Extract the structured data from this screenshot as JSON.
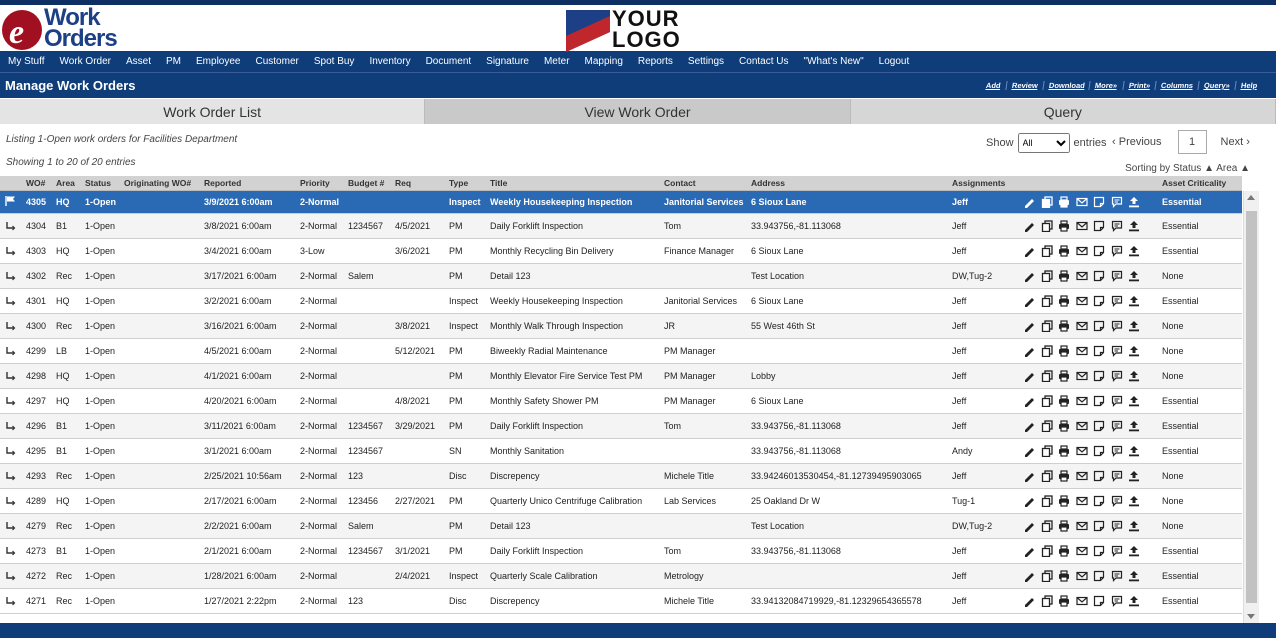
{
  "brand": {
    "logo_line1": "Work",
    "logo_line2": "Orders",
    "placeholder_line1": "YOUR",
    "placeholder_line2": "LOGO",
    "primary": "#0f3d7a",
    "accent": "#a01020"
  },
  "nav": [
    "My Stuff",
    "Work Order",
    "Asset",
    "PM",
    "Employee",
    "Customer",
    "Spot Buy",
    "Inventory",
    "Document",
    "Signature",
    "Meter",
    "Mapping",
    "Reports",
    "Settings",
    "Contact Us",
    "\"What's New\"",
    "Logout"
  ],
  "page_title": "Manage Work Orders",
  "actions": [
    "Add",
    "Review",
    "Download",
    "More»",
    "Print»",
    "Columns",
    "Query»",
    "Help"
  ],
  "tabs": [
    "Work Order List",
    "View Work Order",
    "Query"
  ],
  "listing": "Listing 1-Open work orders for Facilities Department",
  "showing": "Showing 1 to 20 of 20 entries",
  "show_label": "Show",
  "show_value": "All",
  "entries_label": "entries",
  "pager": {
    "previous": "Previous",
    "current": "1",
    "next": "Next"
  },
  "sorting": "Sorting by Status ▲ Area ▲",
  "columns": [
    "WO#",
    "Area",
    "Status",
    "Originating WO#",
    "Reported",
    "Priority",
    "Budget #",
    "Req",
    "Type",
    "Title",
    "Contact",
    "Address",
    "Assignments",
    "Asset Criticality"
  ],
  "row_icons": [
    "pencil-icon",
    "copy-icon",
    "print-icon",
    "email-icon",
    "note-icon",
    "comment-icon",
    "upload-icon"
  ],
  "rows": [
    {
      "wo": "4305",
      "area": "HQ",
      "status": "1-Open",
      "orig": "",
      "reported": "3/9/2021 6:00am",
      "priority": "2-Normal",
      "budget": "",
      "req": "",
      "type": "Inspect",
      "title": "Weekly Housekeeping Inspection",
      "contact": "Janitorial Services",
      "address": "6 Sioux Lane",
      "assign": "Jeff",
      "crit": "Essential"
    },
    {
      "wo": "4304",
      "area": "B1",
      "status": "1-Open",
      "orig": "",
      "reported": "3/8/2021 6:00am",
      "priority": "2-Normal",
      "budget": "1234567",
      "req": "4/5/2021",
      "type": "PM",
      "title": "Daily Forklift Inspection",
      "contact": "Tom",
      "address": "33.943756,-81.113068",
      "assign": "Jeff",
      "crit": "Essential"
    },
    {
      "wo": "4303",
      "area": "HQ",
      "status": "1-Open",
      "orig": "",
      "reported": "3/4/2021 6:00am",
      "priority": "3-Low",
      "budget": "",
      "req": "3/6/2021",
      "type": "PM",
      "title": "Monthly Recycling Bin Delivery",
      "contact": "Finance Manager",
      "address": "6 Sioux Lane",
      "assign": "Jeff",
      "crit": "Essential"
    },
    {
      "wo": "4302",
      "area": "Rec",
      "status": "1-Open",
      "orig": "",
      "reported": "3/17/2021 6:00am",
      "priority": "2-Normal",
      "budget": "Salem",
      "req": "",
      "type": "PM",
      "title": "Detail 123",
      "contact": "",
      "address": "Test Location",
      "assign": "DW,Tug-2",
      "crit": "None"
    },
    {
      "wo": "4301",
      "area": "HQ",
      "status": "1-Open",
      "orig": "",
      "reported": "3/2/2021 6:00am",
      "priority": "2-Normal",
      "budget": "",
      "req": "",
      "type": "Inspect",
      "title": "Weekly Housekeeping Inspection",
      "contact": "Janitorial Services",
      "address": "6 Sioux Lane",
      "assign": "Jeff",
      "crit": "Essential"
    },
    {
      "wo": "4300",
      "area": "Rec",
      "status": "1-Open",
      "orig": "",
      "reported": "3/16/2021 6:00am",
      "priority": "2-Normal",
      "budget": "",
      "req": "3/8/2021",
      "type": "Inspect",
      "title": "Monthly Walk Through Inspection",
      "contact": "JR",
      "address": "55 West 46th St",
      "assign": "Jeff",
      "crit": "None"
    },
    {
      "wo": "4299",
      "area": "LB",
      "status": "1-Open",
      "orig": "",
      "reported": "4/5/2021 6:00am",
      "priority": "2-Normal",
      "budget": "",
      "req": "5/12/2021",
      "type": "PM",
      "title": "Biweekly Radial Maintenance",
      "contact": "PM Manager",
      "address": "",
      "assign": "Jeff",
      "crit": "None"
    },
    {
      "wo": "4298",
      "area": "HQ",
      "status": "1-Open",
      "orig": "",
      "reported": "4/1/2021 6:00am",
      "priority": "2-Normal",
      "budget": "",
      "req": "",
      "type": "PM",
      "title": "Monthly Elevator Fire Service Test PM",
      "contact": "PM Manager",
      "address": "Lobby",
      "assign": "Jeff",
      "crit": "None"
    },
    {
      "wo": "4297",
      "area": "HQ",
      "status": "1-Open",
      "orig": "",
      "reported": "4/20/2021 6:00am",
      "priority": "2-Normal",
      "budget": "",
      "req": "4/8/2021",
      "type": "PM",
      "title": "Monthly Safety Shower PM",
      "contact": "PM Manager",
      "address": "6 Sioux Lane",
      "assign": "Jeff",
      "crit": "Essential"
    },
    {
      "wo": "4296",
      "area": "B1",
      "status": "1-Open",
      "orig": "",
      "reported": "3/11/2021 6:00am",
      "priority": "2-Normal",
      "budget": "1234567",
      "req": "3/29/2021",
      "type": "PM",
      "title": "Daily Forklift Inspection",
      "contact": "Tom",
      "address": "33.943756,-81.113068",
      "assign": "Jeff",
      "crit": "Essential"
    },
    {
      "wo": "4295",
      "area": "B1",
      "status": "1-Open",
      "orig": "",
      "reported": "3/1/2021 6:00am",
      "priority": "2-Normal",
      "budget": "1234567",
      "req": "",
      "type": "SN",
      "title": "Monthly Sanitation",
      "contact": "",
      "address": "33.943756,-81.113068",
      "assign": "Andy",
      "crit": "Essential"
    },
    {
      "wo": "4293",
      "area": "Rec",
      "status": "1-Open",
      "orig": "",
      "reported": "2/25/2021 10:56am",
      "priority": "2-Normal",
      "budget": "123",
      "req": "",
      "type": "Disc",
      "title": "Discrepency",
      "contact": "Michele Title",
      "address": "33.94246013530454,-81.12739495903065",
      "assign": "Jeff",
      "crit": "None"
    },
    {
      "wo": "4289",
      "area": "HQ",
      "status": "1-Open",
      "orig": "",
      "reported": "2/17/2021 6:00am",
      "priority": "2-Normal",
      "budget": "123456",
      "req": "2/27/2021",
      "type": "PM",
      "title": "Quarterly Unico Centrifuge Calibration",
      "contact": "Lab Services",
      "address": "25 Oakland Dr W",
      "assign": "Tug-1",
      "crit": "None"
    },
    {
      "wo": "4279",
      "area": "Rec",
      "status": "1-Open",
      "orig": "",
      "reported": "2/2/2021 6:00am",
      "priority": "2-Normal",
      "budget": "Salem",
      "req": "",
      "type": "PM",
      "title": "Detail 123",
      "contact": "",
      "address": "Test Location",
      "assign": "DW,Tug-2",
      "crit": "None"
    },
    {
      "wo": "4273",
      "area": "B1",
      "status": "1-Open",
      "orig": "",
      "reported": "2/1/2021 6:00am",
      "priority": "2-Normal",
      "budget": "1234567",
      "req": "3/1/2021",
      "type": "PM",
      "title": "Daily Forklift Inspection",
      "contact": "Tom",
      "address": "33.943756,-81.113068",
      "assign": "Jeff",
      "crit": "Essential"
    },
    {
      "wo": "4272",
      "area": "Rec",
      "status": "1-Open",
      "orig": "",
      "reported": "1/28/2021 6:00am",
      "priority": "2-Normal",
      "budget": "",
      "req": "2/4/2021",
      "type": "Inspect",
      "title": "Quarterly Scale Calibration",
      "contact": "Metrology",
      "address": "",
      "assign": "Jeff",
      "crit": "Essential"
    },
    {
      "wo": "4271",
      "area": "Rec",
      "status": "1-Open",
      "orig": "",
      "reported": "1/27/2021 2:22pm",
      "priority": "2-Normal",
      "budget": "123",
      "req": "",
      "type": "Disc",
      "title": "Discrepency",
      "contact": "Michele Title",
      "address": "33.94132084719929,-81.12329654365578",
      "assign": "Jeff",
      "crit": "Essential"
    }
  ]
}
